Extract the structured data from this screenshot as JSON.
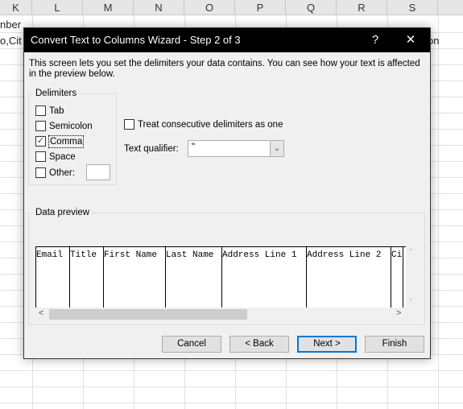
{
  "spreadsheet": {
    "columns": [
      "K",
      "L",
      "M",
      "N",
      "O",
      "P",
      "Q",
      "R",
      "S"
    ],
    "cells": {
      "k1": "nber",
      "k2": "o,Cit",
      "s2": "on"
    }
  },
  "dialog": {
    "title": "Convert Text to Columns Wizard - Step 2 of 3",
    "help_label": "?",
    "close_label": "✕",
    "intro": "This screen lets you set the delimiters your data contains.  You can see how your text is affected in the preview below.",
    "delimiters": {
      "label": "Delimiters",
      "items": [
        {
          "label": "Tab",
          "checked": false
        },
        {
          "label": "Semicolon",
          "checked": false
        },
        {
          "label": "Comma",
          "checked": true
        },
        {
          "label": "Space",
          "checked": false
        },
        {
          "label": "Other:",
          "checked": false
        }
      ],
      "other_value": ""
    },
    "treat_consecutive": {
      "label": "Treat consecutive delimiters as one",
      "checked": false
    },
    "text_qualifier": {
      "label": "Text qualifier:",
      "value": "\""
    },
    "preview": {
      "label": "Data preview",
      "columns": [
        "Email",
        "Title",
        "First Name",
        "Last Name",
        "Address Line 1",
        "Address Line 2",
        "City"
      ]
    },
    "buttons": {
      "cancel": "Cancel",
      "back": "< Back",
      "next": "Next >",
      "finish": "Finish"
    }
  }
}
